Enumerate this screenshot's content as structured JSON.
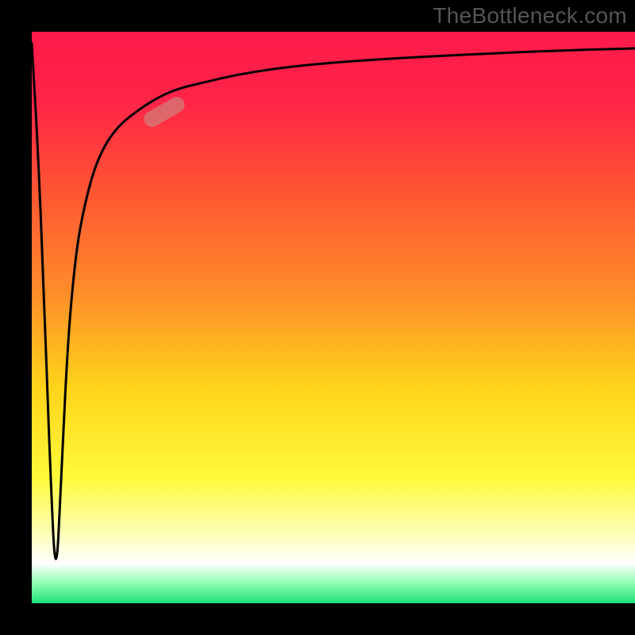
{
  "attribution": "TheBottleneck.com",
  "colors": {
    "frame_bg": "#000000",
    "attribution_text": "#555555",
    "curve_stroke": "#000000",
    "gradient_stops": [
      {
        "offset": 0.0,
        "color": "#ff1a4a"
      },
      {
        "offset": 0.12,
        "color": "#ff2448"
      },
      {
        "offset": 0.28,
        "color": "#ff5533"
      },
      {
        "offset": 0.45,
        "color": "#ff8a2a"
      },
      {
        "offset": 0.62,
        "color": "#ffd31a"
      },
      {
        "offset": 0.78,
        "color": "#fffa3a"
      },
      {
        "offset": 0.88,
        "color": "#fdffba"
      },
      {
        "offset": 0.93,
        "color": "#ffffff"
      },
      {
        "offset": 0.965,
        "color": "#8effb2"
      },
      {
        "offset": 1.0,
        "color": "#1fe07a"
      }
    ],
    "marker_fill": "rgba(200,140,130,0.62)"
  },
  "chart_data": {
    "type": "line",
    "title": "",
    "xlabel": "",
    "ylabel": "",
    "xlim": [
      0,
      100
    ],
    "ylim": [
      0,
      100
    ],
    "grid": false,
    "legend": false,
    "note": "Bottleneck curve: dips near x≈4 to ~0 then rises toward ~97. Values estimated from pixels; no axis labels shown.",
    "series": [
      {
        "name": "bottleneck-curve",
        "x": [
          0,
          1,
          2,
          3,
          4,
          5,
          6,
          7,
          8,
          10,
          12,
          14,
          16,
          20,
          24,
          28,
          34,
          42,
          52,
          64,
          78,
          90,
          100
        ],
        "y": [
          98,
          80,
          55,
          25,
          2,
          25,
          46,
          58,
          66,
          75,
          80,
          83,
          85,
          88,
          90,
          91,
          92.5,
          93.8,
          94.8,
          95.6,
          96.3,
          96.8,
          97.1
        ]
      }
    ],
    "marker": {
      "x": 22,
      "y": 86,
      "angle_deg": 30
    }
  }
}
